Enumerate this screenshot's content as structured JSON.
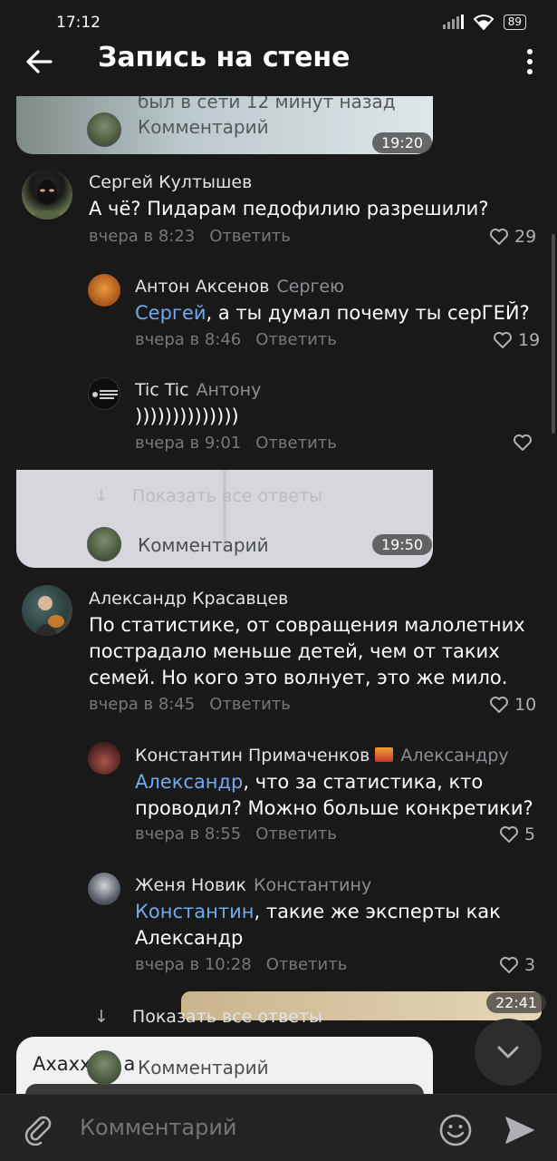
{
  "status_bar": {
    "time": "17:12",
    "battery": "89"
  },
  "header": {
    "title": "Запись на стене"
  },
  "overlay": {
    "faded_status": "был в сети 12 минут назад",
    "comment_label": "Комментарий",
    "time_1": "19:20",
    "show_all_faded": "Показать все ответы",
    "time_2": "19:50",
    "time_3": "22:41",
    "bottom_text": "Ахахх",
    "bottom_text_tail": "а"
  },
  "comments": [
    {
      "name": "Сергей Култышев",
      "text": "А чё? Пидарам педофилию разрешили?",
      "time": "вчера в 8:23",
      "reply": "Ответить",
      "likes": "29"
    },
    {
      "name": "Антон Аксенов",
      "reply_to": "Сергею",
      "mention": "Сергей",
      "text": ", а ты думал почему ты серГЕЙ?",
      "time": "вчера в 8:46",
      "reply": "Ответить",
      "likes": "19"
    },
    {
      "name": "Tic Tic",
      "reply_to": "Антону",
      "text": "))))))))))))))",
      "time": "вчера в 9:01",
      "reply": "Ответить",
      "likes": ""
    },
    {
      "name": "Александр Красавцев",
      "text_lines": [
        "По статистике, от совращения малолетних",
        "пострадало меньше детей, чем от таких",
        "семей. Но кого это волнует, это же мило."
      ],
      "time": "вчера в 8:45",
      "reply": "Ответить",
      "likes": "10"
    },
    {
      "name": "Константин Примаченков",
      "reply_to": "Александру",
      "mention": "Александр",
      "text_line1": ", что за статистика, кто",
      "text_line2": "проводил? Можно больше конкретики?",
      "time": "вчера в 8:55",
      "reply": "Ответить",
      "likes": "5"
    },
    {
      "name": "Женя Новик",
      "reply_to": "Константину",
      "mention": "Константин",
      "text_line1": ", такие же эксперты как",
      "text_line2": "Александр",
      "time": "вчера в 10:28",
      "reply": "Ответить",
      "likes": "3"
    }
  ],
  "show_all": "Показать все ответы",
  "composer": {
    "placeholder": "Комментарий"
  },
  "colors": {
    "background": "#19191a",
    "mention": "#71aaeb",
    "meta": "#76787a"
  }
}
